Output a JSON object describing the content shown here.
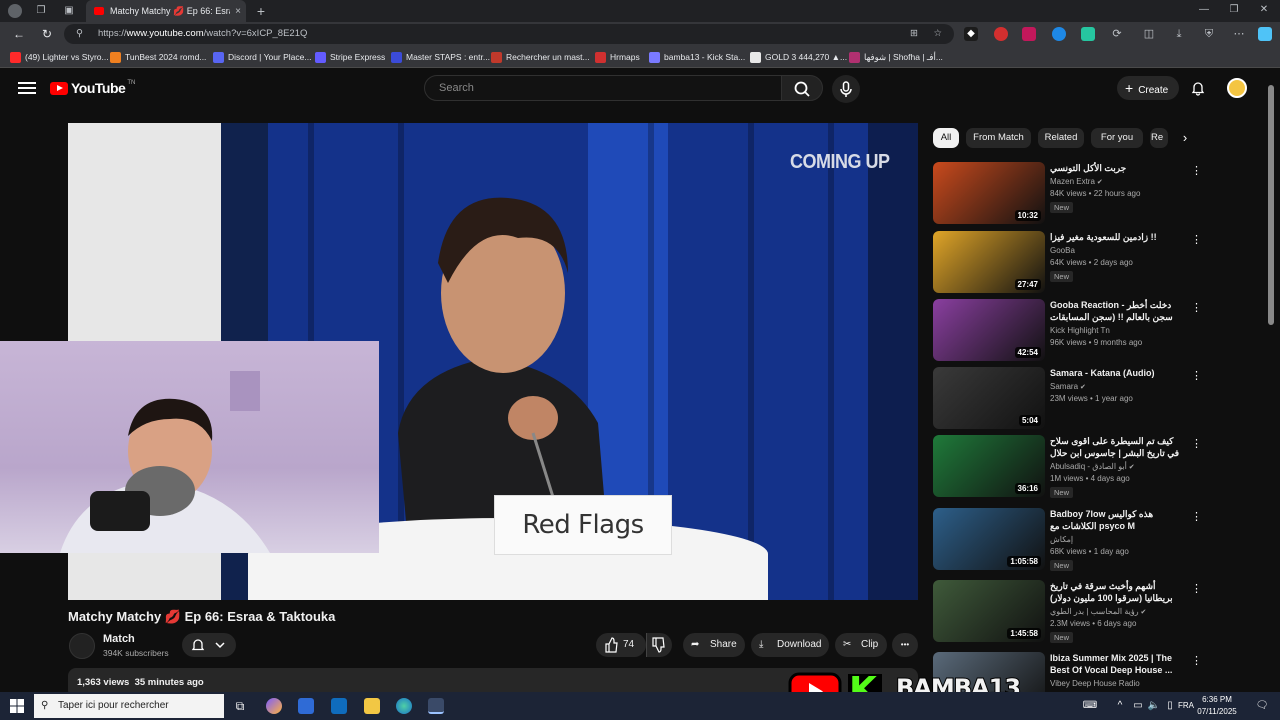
{
  "browser": {
    "tab_title": "Matchy Matchy 💋 Ep 66: Esraa",
    "tab_close": "×",
    "new_tab": "+",
    "url_prefix": "https://",
    "url_domain": "www.youtube.com",
    "url_path": "/watch?v=6xICP_8E21Q"
  },
  "bookmarks": [
    {
      "label": "(49) Lighter vs Styro...",
      "color": "#ff2a2a"
    },
    {
      "label": "TunBest 2024 romd...",
      "color": "#f08020"
    },
    {
      "label": "Discord | Your Place...",
      "color": "#5865f2"
    },
    {
      "label": "Stripe Express",
      "color": "#635bff"
    },
    {
      "label": "Master STAPS : entr...",
      "color": "#3b4bd8"
    },
    {
      "label": "Rechercher un mast...",
      "color": "#c0392b"
    },
    {
      "label": "Hrmaps",
      "color": "#d03030"
    },
    {
      "label": "bamba13 - Kick Sta...",
      "color": "#7a7aff"
    },
    {
      "label": "GOLD 3 444,270 ▲...",
      "color": "#e8e8e8"
    },
    {
      "label": "شوفها | Shofha | أفـ...",
      "color": "#b03070"
    }
  ],
  "youtube": {
    "logo_text": "YouTube",
    "logo_country": "TN",
    "search_placeholder": "Search",
    "create_label": "Create"
  },
  "video": {
    "overlay_coming_up": "COMING UP",
    "overlay_sign": "Red Flags",
    "title": "Matchy Matchy 💋 Ep 66: Esraa & Taktouka",
    "channel_name": "Match",
    "subscribers": "394K subscribers",
    "likes": "74",
    "share_label": "Share",
    "download_label": "Download",
    "clip_label": "Clip",
    "more_label": "•••",
    "views_time": "1,363 views  35 minutes ago"
  },
  "chips": [
    "All",
    "From Match",
    "Related",
    "For you",
    "Re"
  ],
  "recommended": [
    {
      "title": "جربت الأكل التونسي",
      "channel": "Mazen Extra",
      "verified": true,
      "meta": "84K views • 22 hours ago",
      "badge": "New",
      "duration": "10:32",
      "thumb": "#c94a1d"
    },
    {
      "title": "زادمين للسعودية مغير فيزا !!",
      "channel": "GooBa",
      "verified": false,
      "meta": "64K views • 2 days ago",
      "badge": "New",
      "duration": "27:47",
      "thumb": "#e0a528"
    },
    {
      "title": "Gooba Reaction - دخلت أخطر سجن بالعالم !! (سجن المسابقات في السلفادور) ...",
      "channel": "Kick Highlight Tn",
      "verified": false,
      "meta": "96K views • 9 months ago",
      "badge": "",
      "duration": "42:54",
      "thumb": "#8a3fa0"
    },
    {
      "title": "Samara - Katana (Audio)",
      "channel": "Samara",
      "verified": true,
      "meta": "23M views • 1 year ago",
      "badge": "",
      "duration": "5:04",
      "thumb": "#3a3a3a"
    },
    {
      "title": "كيف تم السيطرة على اقوى سلاح في تاريخ البشر | جاسوس ابن حلال",
      "channel": "Abulsadiq - أبو الصادق",
      "verified": true,
      "meta": "1M views • 4 days ago",
      "badge": "New",
      "duration": "36:16",
      "thumb": "#1f7a3a"
    },
    {
      "title": "Badboy 7low هذه كواليس الكلاشات مع psyco M",
      "channel": "إمكاش",
      "verified": false,
      "meta": "68K views • 1 day ago",
      "badge": "New",
      "duration": "1:05:58",
      "thumb": "#2d5f8a"
    },
    {
      "title": "أشهم وأخبث سرقة في تاريخ بريطانيا (سرقوا 100 مليون دولار)",
      "channel": "رؤية المحاسب | بدر الطوي",
      "verified": true,
      "meta": "2.3M views • 6 days ago",
      "badge": "New",
      "duration": "1:45:58",
      "thumb": "#3f5a3a"
    },
    {
      "title": "Ibiza Summer Mix 2025 | The Best Of Vocal Deep House ...",
      "channel": "Vibey Deep House Radio",
      "verified": false,
      "meta": "",
      "badge": "",
      "duration": "",
      "thumb": "#5a6a7a"
    }
  ],
  "taskbar": {
    "search_placeholder": "Taper ici pour rechercher",
    "lang": "FRA",
    "time": "6:36 PM",
    "date": "07/11/2025"
  },
  "stream_overlay": {
    "name": "BAMBA13",
    "k_letter": "K"
  },
  "colors": {
    "yt_red": "#ff0000",
    "kick_green": "#53fc18",
    "bg": "#0f0f0f"
  }
}
